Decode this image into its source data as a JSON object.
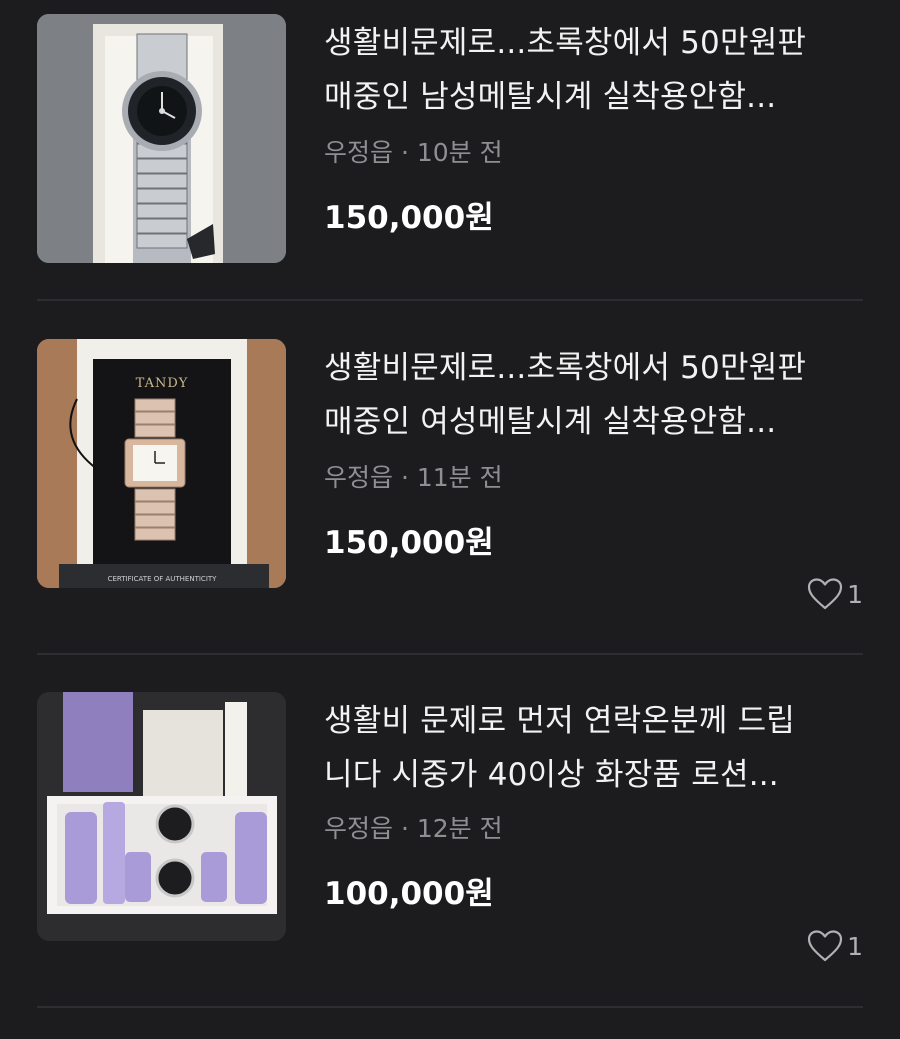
{
  "listings": [
    {
      "title_line1": "생활비문제로...초록창에서 50만원판",
      "title_line2": "매중인 남성메탈시계 실착용안함...",
      "location": "우정읍",
      "separator": "·",
      "time": "10분 전",
      "price": "150,000원",
      "likes": null,
      "image": "mens-metal-watch"
    },
    {
      "title_line1": "생활비문제로...초록창에서 50만원판",
      "title_line2": "매중인 여성메탈시계 실착용안함...",
      "location": "우정읍",
      "separator": "·",
      "time": "11분 전",
      "price": "150,000원",
      "likes": "1",
      "image": "womens-metal-watch",
      "image_text_brand": "TANDY",
      "image_text_card": "CERTIFICATE OF AUTHENTICITY"
    },
    {
      "title_line1": "생활비 문제로 먼저 연락온분께 드립",
      "title_line2": "니다 시중가 40이상 화장품  로션...",
      "location": "우정읍",
      "separator": "·",
      "time": "12분 전",
      "price": "100,000원",
      "likes": "1",
      "image": "cosmetics-set"
    }
  ],
  "colors": {
    "background": "#1c1c1e",
    "title": "#f2f2f2",
    "meta": "#8e8e93",
    "price": "#ffffff",
    "divider": "#2e2e32"
  }
}
